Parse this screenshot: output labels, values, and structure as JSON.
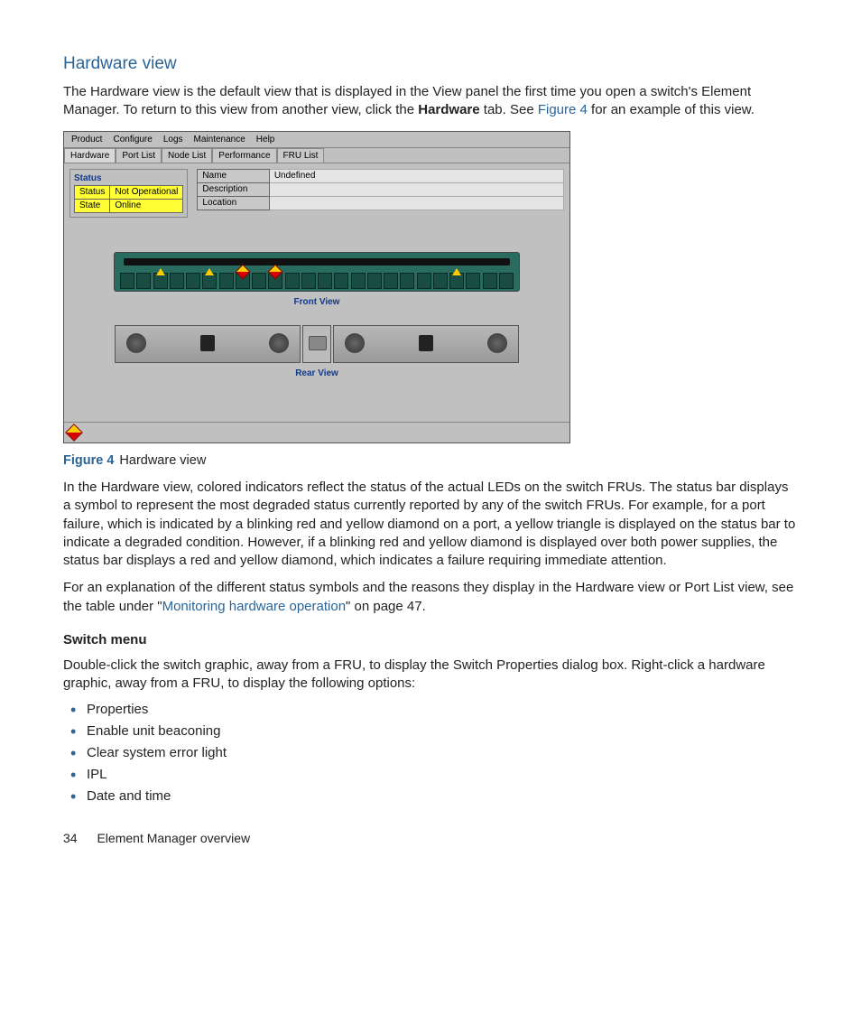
{
  "heading": "Hardware view",
  "para1_a": "The Hardware view is the default view that is displayed in the View panel the first time you open a switch's Element Manager. To return to this view from another view, click the ",
  "para1_bold": "Hardware",
  "para1_b": " tab. See ",
  "para1_link": "Figure 4",
  "para1_c": " for an example of this view.",
  "app": {
    "menus": [
      "Product",
      "Configure",
      "Logs",
      "Maintenance",
      "Help"
    ],
    "tabs": [
      "Hardware",
      "Port List",
      "Node List",
      "Performance",
      "FRU List"
    ],
    "status_title": "Status",
    "status_rows": [
      {
        "k": "Status",
        "v": "Not Operational"
      },
      {
        "k": "State",
        "v": "Online"
      }
    ],
    "info_rows": [
      {
        "k": "Name",
        "v": "Undefined"
      },
      {
        "k": "Description",
        "v": ""
      },
      {
        "k": "Location",
        "v": ""
      }
    ],
    "front_label": "Front View",
    "rear_label": "Rear View"
  },
  "figure_label": "Figure 4",
  "figure_text": "Hardware view",
  "para2": "In the Hardware view, colored indicators reflect the status of the actual LEDs on the switch FRUs. The status bar displays a symbol to represent the most degraded status currently reported by any of the switch FRUs. For example, for a port failure, which is indicated by a blinking red and yellow diamond on a port, a yellow triangle is displayed on the status bar to indicate a degraded condition. However, if a blinking red and yellow diamond is displayed over both power supplies, the status bar displays a red and yellow diamond, which indicates a failure requiring immediate attention.",
  "para3_a": "For an explanation of the different status symbols and the reasons they display in the Hardware view or Port List view, see the table under \"",
  "para3_link": "Monitoring hardware operation",
  "para3_b": "\" on page 47.",
  "sub_heading": "Switch menu",
  "para4": "Double-click the switch graphic, away from a FRU, to display the Switch Properties dialog box. Right-click a hardware graphic, away from a FRU, to display the following options:",
  "bullets": [
    "Properties",
    "Enable unit beaconing",
    "Clear system error light",
    "IPL",
    "Date and time"
  ],
  "footer_page": "34",
  "footer_text": "Element Manager overview"
}
